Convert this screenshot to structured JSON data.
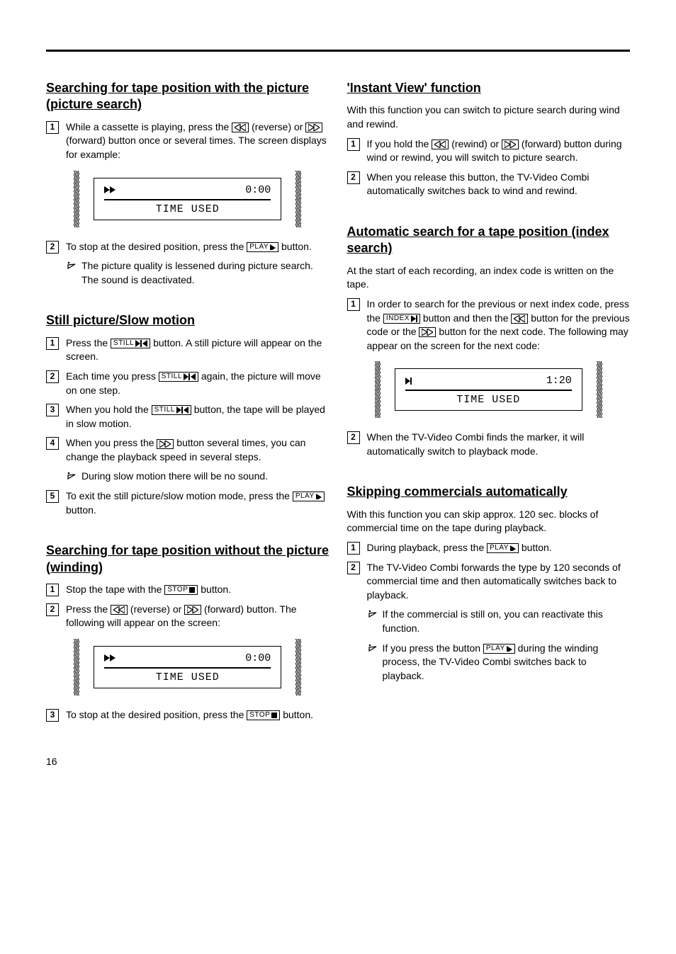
{
  "pageNumber": "16",
  "buttons": {
    "play": "PLAY",
    "still": "STILL",
    "stop": "STOP",
    "index": "INDEX"
  },
  "osd": {
    "time1": "0:00",
    "time2": "0:00",
    "time3": "1:20",
    "label": "TIME USED"
  },
  "left": {
    "sec1": {
      "heading": "Searching for tape position with the picture (picture search)",
      "step1a": "While a cassette is playing, press the ",
      "step1b": " (reverse) or ",
      "step1c": " (forward) button once or several times. The screen displays for example:",
      "step2a": "To stop at the desired position, press the ",
      "step2b": " button.",
      "tip1": "The picture quality is lessened during picture search. The sound is deactivated."
    },
    "sec2": {
      "heading": "Still picture/Slow motion",
      "step1a": "Press the ",
      "step1b": " button. A still picture will appear on the screen.",
      "step2a": "Each time you press ",
      "step2b": " again, the picture will move on one step.",
      "step3a": "When you hold the ",
      "step3b": " button, the tape will be played in slow motion.",
      "step4a": "When you press the ",
      "step4b": " button several times, you can change the playback speed in several steps.",
      "tip1": "During slow motion there will be no sound.",
      "step5a": "To exit the still picture/slow motion mode, press the ",
      "step5b": " button."
    },
    "sec3": {
      "heading": "Searching for tape position without the picture (winding)",
      "step1a": "Stop the tape with the ",
      "step1b": " button.",
      "step2a": "Press the ",
      "step2b": " (reverse) or ",
      "step2c": " (forward) button. The following will appear on the screen:",
      "step3a": "To stop at the desired position, press the ",
      "step3b": " button."
    }
  },
  "right": {
    "sec1": {
      "heading": "'Instant View' function",
      "intro": "With this function you can switch to picture search during wind and rewind.",
      "step1a": "If you hold the ",
      "step1b": " (rewind) or ",
      "step1c": " (forward) button during wind or rewind, you will switch to picture search.",
      "step2": "When you release this button, the TV-Video Combi automatically switches back to wind and rewind."
    },
    "sec2": {
      "heading": "Automatic search for a tape position (index search)",
      "intro": "At the start of each recording, an index code is written on the tape.",
      "step1a": "In order to search for the previous or next index code, press the ",
      "step1b": " button and then the ",
      "step1c": " button for the previous code or the ",
      "step1d": " button for the next code. The following may appear on the screen for the next code:",
      "step2": "When the TV-Video Combi finds the marker, it will automatically switch to playback mode."
    },
    "sec3": {
      "heading": "Skipping commercials automatically",
      "intro": "With this function you can skip approx. 120 sec. blocks of commercial time on the tape during playback.",
      "step1a": "During playback, press the ",
      "step1b": " button.",
      "step2": "The TV-Video Combi forwards the type by 120 seconds of commercial time and then automatically switches back to playback.",
      "tip1": "If the commercial is still on, you can reactivate this function.",
      "tip2a": "If you press the button ",
      "tip2b": " during the winding process, the TV-Video Combi switches back to playback."
    }
  }
}
